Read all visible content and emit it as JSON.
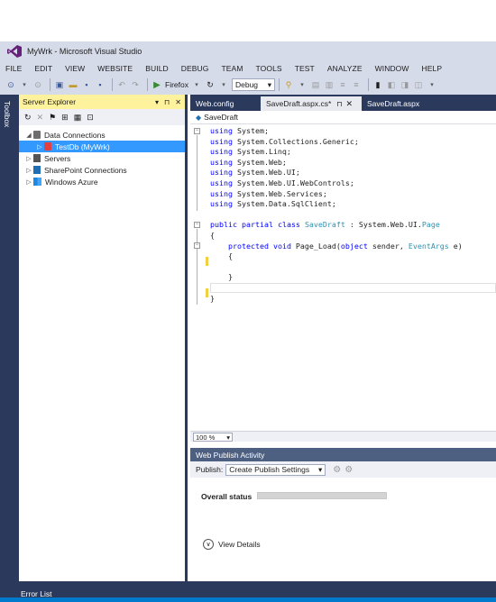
{
  "window": {
    "title": "MyWrk - Microsoft Visual Studio"
  },
  "menu": [
    "FILE",
    "EDIT",
    "VIEW",
    "WEBSITE",
    "BUILD",
    "DEBUG",
    "TEAM",
    "TOOLS",
    "TEST",
    "ANALYZE",
    "WINDOW",
    "HELP"
  ],
  "toolbar": {
    "browser_label": "Firefox",
    "config_value": "Debug"
  },
  "toolbox": {
    "label": "Toolbox"
  },
  "server_explorer": {
    "title": "Server Explorer",
    "header_icons": "▾ ⊓ ✕",
    "tree": [
      {
        "label": "Data Connections",
        "expanded": true,
        "indent": 0
      },
      {
        "label": "TestDb (MyWrk)",
        "expanded": false,
        "indent": 1,
        "selected": true
      },
      {
        "label": "Servers",
        "expanded": false,
        "indent": 0
      },
      {
        "label": "SharePoint Connections",
        "expanded": false,
        "indent": 0
      },
      {
        "label": "Windows Azure",
        "expanded": false,
        "indent": 0
      }
    ]
  },
  "editor": {
    "tabs": [
      {
        "label": "Web.config"
      },
      {
        "label": "SaveDraft.aspx.cs*",
        "active": true
      },
      {
        "label": "SaveDraft.aspx"
      }
    ],
    "nav_class": "SaveDraft",
    "zoom": "100 %"
  },
  "code": [
    [
      [
        "kw",
        "using"
      ],
      [
        "tx",
        " System;"
      ]
    ],
    [
      [
        "kw",
        "using"
      ],
      [
        "tx",
        " System.Collections.Generic;"
      ]
    ],
    [
      [
        "kw",
        "using"
      ],
      [
        "tx",
        " System.Linq;"
      ]
    ],
    [
      [
        "kw",
        "using"
      ],
      [
        "tx",
        " System.Web;"
      ]
    ],
    [
      [
        "kw",
        "using"
      ],
      [
        "tx",
        " System.Web.UI;"
      ]
    ],
    [
      [
        "kw",
        "using"
      ],
      [
        "tx",
        " System.Web.UI.WebControls;"
      ]
    ],
    [
      [
        "kw",
        "using"
      ],
      [
        "tx",
        " System.Web.Services;"
      ]
    ],
    [
      [
        "kw",
        "using"
      ],
      [
        "tx",
        " System.Data.SqlClient;"
      ]
    ],
    [],
    [
      [
        "kw",
        "public"
      ],
      [
        "tx",
        " "
      ],
      [
        "kw",
        "partial"
      ],
      [
        "tx",
        " "
      ],
      [
        "kw",
        "class"
      ],
      [
        "tx",
        " "
      ],
      [
        "tp",
        "SaveDraft"
      ],
      [
        "tx",
        " : System.Web.UI."
      ],
      [
        "tp",
        "Page"
      ]
    ],
    [
      [
        "tx",
        "{"
      ]
    ],
    [
      [
        "tx",
        "    "
      ],
      [
        "kw",
        "protected"
      ],
      [
        "tx",
        " "
      ],
      [
        "kw",
        "void"
      ],
      [
        "tx",
        " Page_Load("
      ],
      [
        "kw",
        "object"
      ],
      [
        "tx",
        " sender, "
      ],
      [
        "tp",
        "EventArgs"
      ],
      [
        "tx",
        " e)"
      ]
    ],
    [
      [
        "tx",
        "    {"
      ]
    ],
    [],
    [
      [
        "tx",
        "    }"
      ]
    ],
    [],
    [
      [
        "tx",
        "}"
      ]
    ]
  ],
  "publish": {
    "title": "Web Publish Activity",
    "publish_label": "Publish:",
    "publish_select": "Create Publish Settings",
    "overall_status_label": "Overall status",
    "progress": 0,
    "view_details": "View Details"
  },
  "bottom": {
    "error_list": "Error List"
  },
  "colors": {
    "accent": "#007acc",
    "selection": "#3399ff",
    "panel_header": "#fff29d",
    "chrome": "#d6dbe9",
    "dark": "#2b3a5c"
  }
}
